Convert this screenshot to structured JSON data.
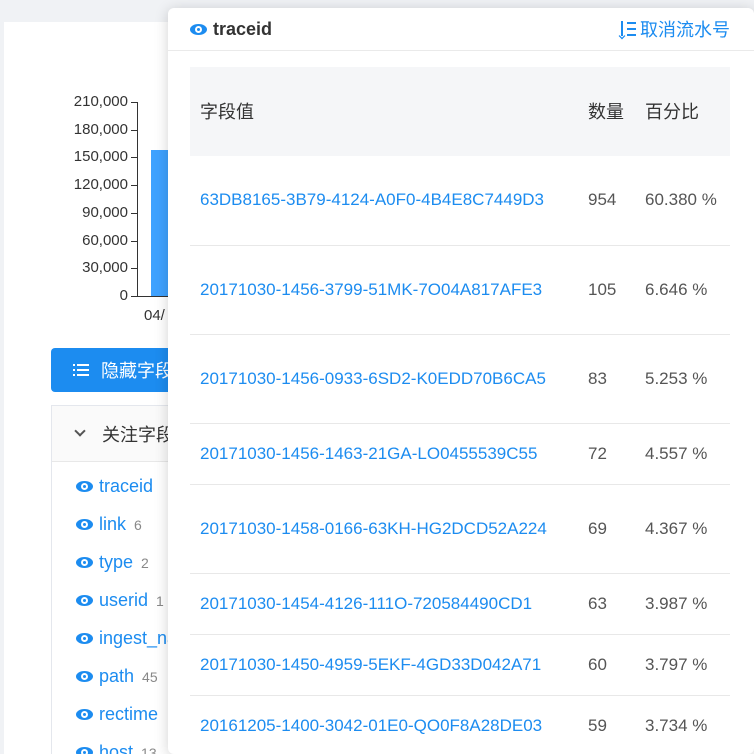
{
  "chart": {
    "y_ticks": [
      "210,000",
      "180,000",
      "150,000",
      "120,000",
      "90,000",
      "60,000",
      "30,000",
      "0"
    ],
    "x_label": "04/",
    "chart_data": {
      "type": "bar",
      "categories": [
        "04/"
      ],
      "values": [
        158000
      ],
      "ylim": [
        0,
        210000
      ]
    }
  },
  "hide_button_label": "隐藏字段",
  "fields_panel": {
    "header": "关注字段",
    "items": [
      {
        "name": "traceid",
        "count": ""
      },
      {
        "name": "link",
        "count": "6"
      },
      {
        "name": "type",
        "count": "2"
      },
      {
        "name": "userid",
        "count": "1"
      },
      {
        "name": "ingest_na",
        "count": ""
      },
      {
        "name": "path",
        "count": "45"
      },
      {
        "name": "rectime",
        "count": ""
      },
      {
        "name": "host",
        "count": "13"
      }
    ]
  },
  "popup": {
    "title": "traceid",
    "action": "取消流水号",
    "columns": [
      "字段值",
      "数量",
      "百分比"
    ],
    "rows": [
      {
        "value": "63DB8165-3B79-4124-A0F0-4B4E8C7449D3",
        "count": "954",
        "percent": "60.380 %"
      },
      {
        "value": "20171030-1456-3799-51MK-7O04A817AFE3",
        "count": "105",
        "percent": "6.646 %"
      },
      {
        "value": "20171030-1456-0933-6SD2-K0EDD70B6CA5",
        "count": "83",
        "percent": "5.253 %"
      },
      {
        "value": "20171030-1456-1463-21GA-LO0455539C55",
        "count": "72",
        "percent": "4.557 %"
      },
      {
        "value": "20171030-1458-0166-63KH-HG2DCD52A224",
        "count": "69",
        "percent": "4.367 %"
      },
      {
        "value": "20171030-1454-4126-111O-720584490CD1",
        "count": "63",
        "percent": "3.987 %"
      },
      {
        "value": "20171030-1450-4959-5EKF-4GD33D042A71",
        "count": "60",
        "percent": "3.797 %"
      },
      {
        "value": "20161205-1400-3042-01E0-QO0F8A28DE03",
        "count": "59",
        "percent": "3.734 %"
      }
    ]
  },
  "colors": {
    "accent": "#1c8cf0",
    "bar": "#3fa2ff"
  }
}
